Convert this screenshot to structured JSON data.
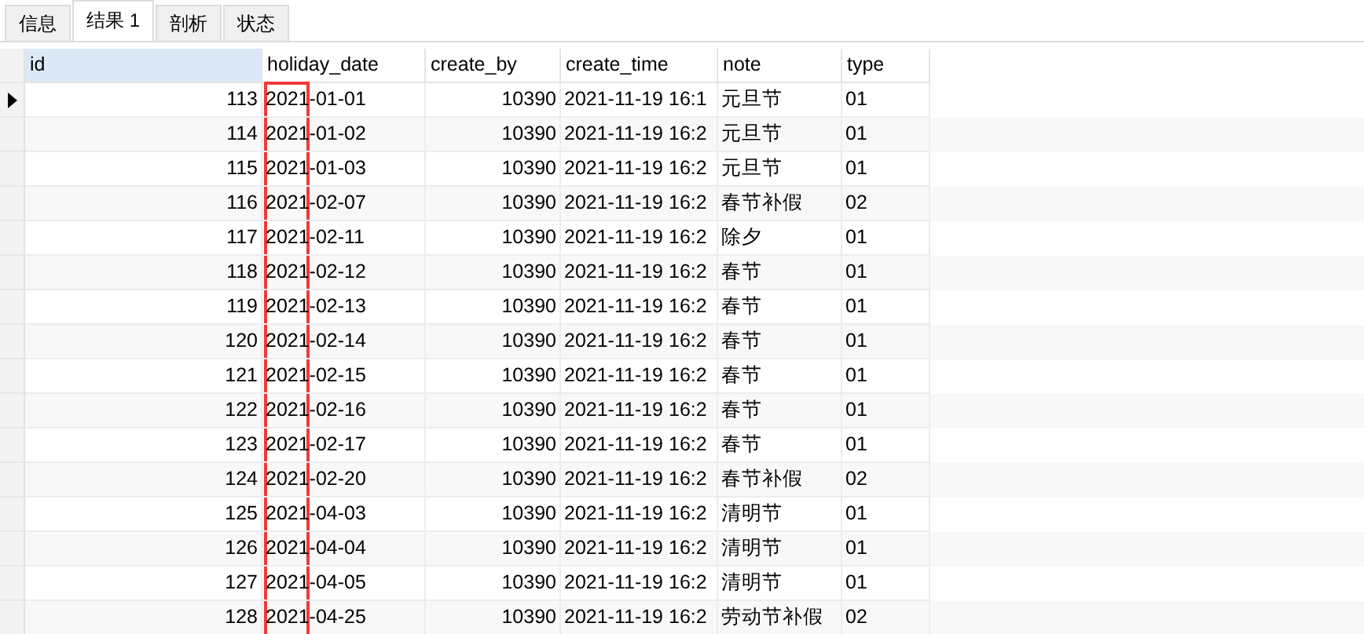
{
  "tabs": [
    {
      "label": "信息",
      "selected": false
    },
    {
      "label": "结果 1",
      "selected": true
    },
    {
      "label": "剖析",
      "selected": false
    },
    {
      "label": "状态",
      "selected": false
    }
  ],
  "table": {
    "columns": [
      "id",
      "holiday_date",
      "create_by",
      "create_time",
      "note",
      "type"
    ],
    "rows": [
      {
        "current": true,
        "cells": [
          "113",
          "2021-01-01",
          "10390",
          "2021-11-19 16:1",
          "元旦节",
          "01"
        ]
      },
      {
        "current": false,
        "cells": [
          "114",
          "2021-01-02",
          "10390",
          "2021-11-19 16:2",
          "元旦节",
          "01"
        ]
      },
      {
        "current": false,
        "cells": [
          "115",
          "2021-01-03",
          "10390",
          "2021-11-19 16:2",
          "元旦节",
          "01"
        ]
      },
      {
        "current": false,
        "cells": [
          "116",
          "2021-02-07",
          "10390",
          "2021-11-19 16:2",
          "春节补假",
          "02"
        ]
      },
      {
        "current": false,
        "cells": [
          "117",
          "2021-02-11",
          "10390",
          "2021-11-19 16:2",
          "除夕",
          "01"
        ]
      },
      {
        "current": false,
        "cells": [
          "118",
          "2021-02-12",
          "10390",
          "2021-11-19 16:2",
          "春节",
          "01"
        ]
      },
      {
        "current": false,
        "cells": [
          "119",
          "2021-02-13",
          "10390",
          "2021-11-19 16:2",
          "春节",
          "01"
        ]
      },
      {
        "current": false,
        "cells": [
          "120",
          "2021-02-14",
          "10390",
          "2021-11-19 16:2",
          "春节",
          "01"
        ]
      },
      {
        "current": false,
        "cells": [
          "121",
          "2021-02-15",
          "10390",
          "2021-11-19 16:2",
          "春节",
          "01"
        ]
      },
      {
        "current": false,
        "cells": [
          "122",
          "2021-02-16",
          "10390",
          "2021-11-19 16:2",
          "春节",
          "01"
        ]
      },
      {
        "current": false,
        "cells": [
          "123",
          "2021-02-17",
          "10390",
          "2021-11-19 16:2",
          "春节",
          "01"
        ]
      },
      {
        "current": false,
        "cells": [
          "124",
          "2021-02-20",
          "10390",
          "2021-11-19 16:2",
          "春节补假",
          "02"
        ]
      },
      {
        "current": false,
        "cells": [
          "125",
          "2021-04-03",
          "10390",
          "2021-11-19 16:2",
          "清明节",
          "01"
        ]
      },
      {
        "current": false,
        "cells": [
          "126",
          "2021-04-04",
          "10390",
          "2021-11-19 16:2",
          "清明节",
          "01"
        ]
      },
      {
        "current": false,
        "cells": [
          "127",
          "2021-04-05",
          "10390",
          "2021-11-19 16:2",
          "清明节",
          "01"
        ]
      },
      {
        "current": false,
        "cells": [
          "128",
          "2021-04-25",
          "10390",
          "2021-11-19 16:2",
          "劳动节补假",
          "02"
        ]
      }
    ]
  }
}
